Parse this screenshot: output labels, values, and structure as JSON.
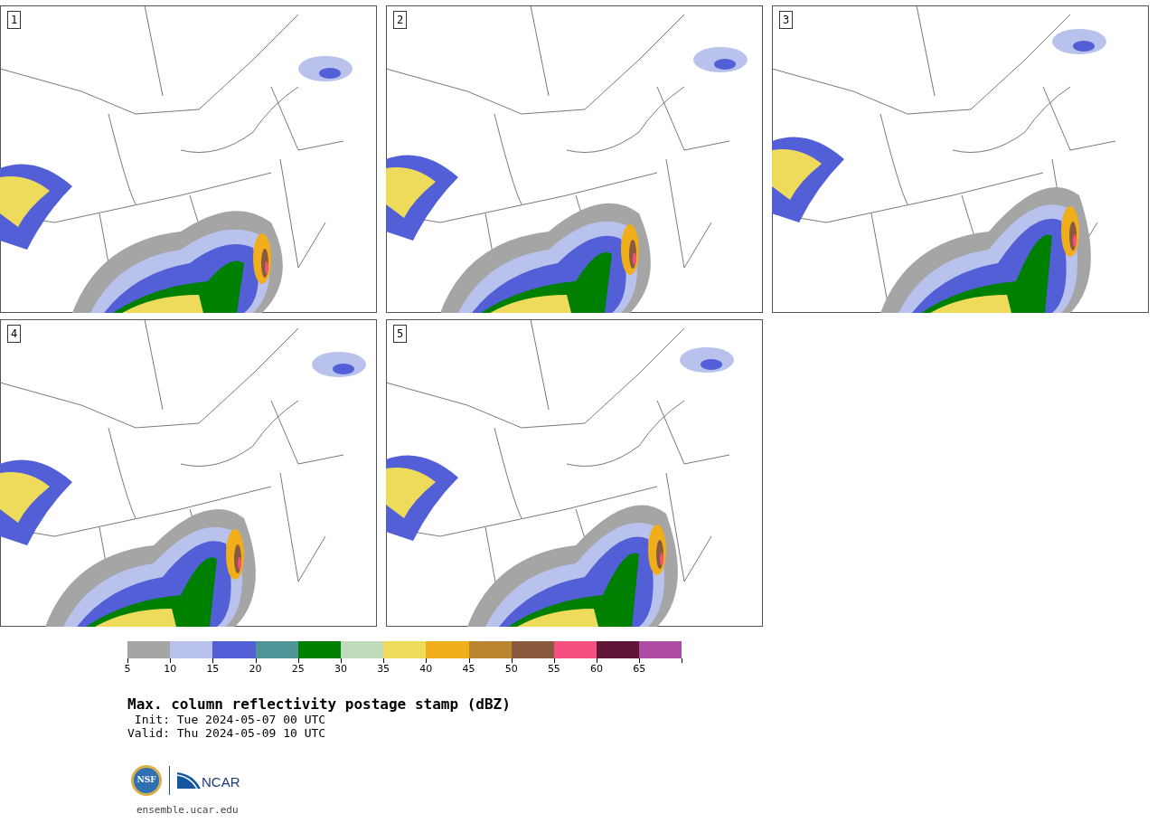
{
  "panels": [
    {
      "label": "1"
    },
    {
      "label": "2"
    },
    {
      "label": "3"
    },
    {
      "label": "4"
    },
    {
      "label": "5"
    }
  ],
  "colorbar": {
    "bins": [
      {
        "color": "#a5a5a5"
      },
      {
        "color": "#b8c2ec"
      },
      {
        "color": "#525fd6"
      },
      {
        "color": "#4f9597"
      },
      {
        "color": "#008000"
      },
      {
        "color": "#bedcbc"
      },
      {
        "color": "#eedb5c"
      },
      {
        "color": "#f0ae1a"
      },
      {
        "color": "#bb8430"
      },
      {
        "color": "#8a5a3e"
      },
      {
        "color": "#f5507f"
      },
      {
        "color": "#601636"
      },
      {
        "color": "#ad4ba5"
      }
    ],
    "ticks": [
      "5",
      "10",
      "15",
      "20",
      "25",
      "30",
      "35",
      "40",
      "45",
      "50",
      "55",
      "60",
      "65"
    ]
  },
  "title": "Max. column reflectivity postage stamp (dBZ)",
  "init": " Init: Tue 2024-05-07 00 UTC",
  "valid": "Valid: Thu 2024-05-09 10 UTC",
  "logo": {
    "nsf": "NSF",
    "ncar": "NCAR"
  },
  "footer": "ensemble.ucar.edu"
}
